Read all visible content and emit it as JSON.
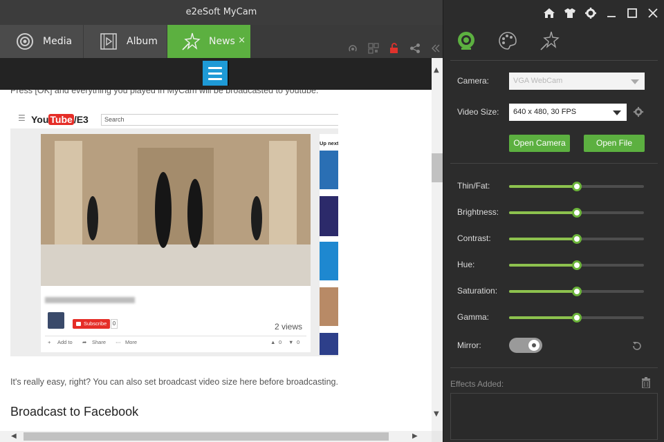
{
  "window": {
    "title": "e2eSoft MyCam"
  },
  "tabs": [
    {
      "label": "Media"
    },
    {
      "label": "Album"
    },
    {
      "label": "News",
      "close": "×"
    }
  ],
  "content": {
    "intro": "Press [OK] and everything you played in MyCam will be broadcasted to youtube.",
    "youtube": {
      "logo_you": "You",
      "logo_tube": "Tube",
      "logo_suffix": "/E3",
      "search_placeholder": "Search",
      "subscribe_label": "Subscribe",
      "sub_count": "0",
      "views": "2 views",
      "actions": {
        "add": "Add to",
        "share": "Share",
        "more": "More",
        "likes": "0",
        "dislikes": "0"
      },
      "up_next": "Up next"
    },
    "paragraph": "It's really easy, right? You can also set broadcast video size here before broadcasting.",
    "heading": "Broadcast to Facebook"
  },
  "camera": {
    "label": "Camera:",
    "value": "VGA WebCam",
    "video_size_label": "Video Size:",
    "video_size_value": "640 x 480, 30 FPS",
    "open_camera": "Open Camera",
    "open_file": "Open File"
  },
  "adjustments": [
    {
      "label": "Thin/Fat:",
      "value": 0.5
    },
    {
      "label": "Brightness:",
      "value": 0.5
    },
    {
      "label": "Contrast:",
      "value": 0.5
    },
    {
      "label": "Hue:",
      "value": 0.5
    },
    {
      "label": "Saturation:",
      "value": 0.5
    },
    {
      "label": "Gamma:",
      "value": 0.5
    }
  ],
  "mirror": {
    "label": "Mirror:",
    "on": true
  },
  "effects": {
    "label": "Effects Added:"
  },
  "colors": {
    "accent": "#5cb040",
    "slider_fill": "#8dc24e",
    "menu_blue": "#1e9ad6"
  }
}
